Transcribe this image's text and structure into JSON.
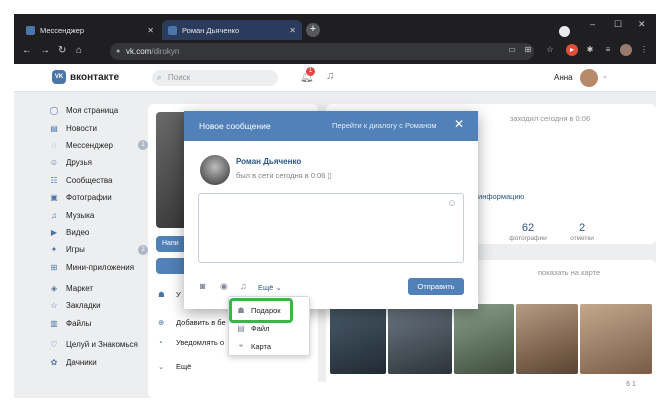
{
  "browser": {
    "tabs": [
      {
        "label": "Мессенджер",
        "active": false
      },
      {
        "label": "Роман Дьяченко",
        "active": true
      }
    ],
    "url_host": "vk.com",
    "url_path": "/dirokyn",
    "window_controls": [
      "–",
      "☐",
      "✕"
    ]
  },
  "vk": {
    "logo_text": "вконтакте",
    "search_placeholder": "Поиск",
    "notifications_count": "1",
    "user_name": "Анна",
    "nav": [
      {
        "label": "Моя страница",
        "icon": "user-icon",
        "badge": ""
      },
      {
        "label": "Новости",
        "icon": "news-icon",
        "badge": ""
      },
      {
        "label": "Мессенджер",
        "icon": "message-icon",
        "badge": "1"
      },
      {
        "label": "Друзья",
        "icon": "friends-icon",
        "badge": ""
      },
      {
        "label": "Сообщества",
        "icon": "communities-icon",
        "badge": ""
      },
      {
        "label": "Фотографии",
        "icon": "photo-icon",
        "badge": ""
      },
      {
        "label": "Музыка",
        "icon": "music-icon",
        "badge": ""
      },
      {
        "label": "Видео",
        "icon": "video-icon",
        "badge": ""
      },
      {
        "label": "Игры",
        "icon": "games-icon",
        "badge": "2"
      },
      {
        "label": "Мини-приложения",
        "icon": "apps-icon",
        "badge": ""
      },
      {
        "label": "Маркет",
        "icon": "market-icon",
        "badge": ""
      },
      {
        "label": "Закладки",
        "icon": "bookmark-icon",
        "badge": ""
      },
      {
        "label": "Файлы",
        "icon": "file-icon",
        "badge": ""
      },
      {
        "label": "Целуй и Знакомься",
        "icon": "heart-app-icon",
        "badge": ""
      },
      {
        "label": "Дачники",
        "icon": "garden-app-icon",
        "badge": ""
      }
    ],
    "profile_side": {
      "write_btn": "Напи",
      "gift_partial": "У",
      "add_friend": "Добавить в бе",
      "notify": "Уведомлять о",
      "more": "Ещё"
    },
    "info": {
      "last_seen": "заходил сегодня в 0:06",
      "info_link": "информацию",
      "stats": [
        {
          "value": "62",
          "label": "фотографии"
        },
        {
          "value": "2",
          "label": "отметки"
        }
      ]
    },
    "show_on_map": "показать на карте",
    "zoom_chip": "6 1"
  },
  "modal": {
    "title": "Новое сообщение",
    "go_to_dialog": "Перейти к диалогу с Романом",
    "recipient_name": "Роман Дьяченко",
    "recipient_status": "был в сети сегодня в 0:06",
    "message_value": "",
    "more_label": "Ещё",
    "send_label": "Отправить"
  },
  "dropdown": {
    "items": [
      {
        "label": "Подарок",
        "icon": "gift-icon"
      },
      {
        "label": "Файл",
        "icon": "file-icon"
      },
      {
        "label": "Карта",
        "icon": "map-pin-icon"
      }
    ],
    "highlight_color": "#39b54a"
  },
  "colors": {
    "vk_blue": "#5181b8",
    "link_blue": "#2a5885",
    "page_bg": "#edeef0"
  }
}
